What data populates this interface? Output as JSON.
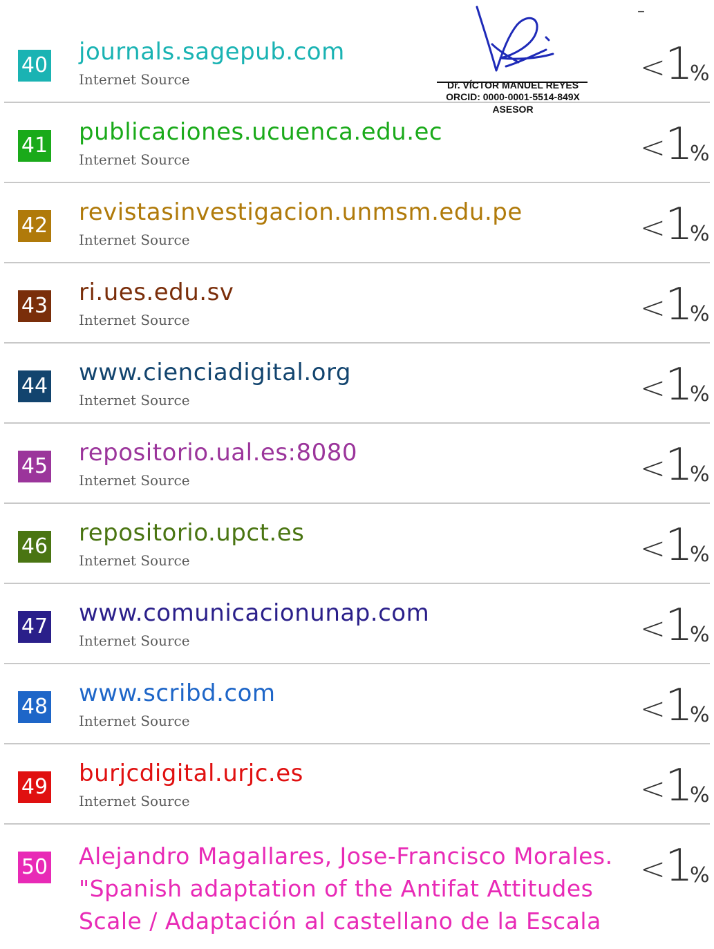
{
  "top_mark": "–",
  "signature": {
    "name": "Dr. VÍCTOR MANUEL REYES",
    "orcid": "ORCID: 0000-0001-5514-849X",
    "role": "ASESOR"
  },
  "percent": {
    "lt": "<",
    "num": "1",
    "sign": "%"
  },
  "sources": [
    {
      "num": "40",
      "title": "journals.sagepub.com",
      "type": "Internet Source",
      "color": "#1ab3b3"
    },
    {
      "num": "41",
      "title": "publicaciones.ucuenca.edu.ec",
      "type": "Internet Source",
      "color": "#1aaa1a"
    },
    {
      "num": "42",
      "title": "revistasinvestigacion.unmsm.edu.pe",
      "type": "Internet Source",
      "color": "#b07a0a"
    },
    {
      "num": "43",
      "title": "ri.ues.edu.sv",
      "type": "Internet Source",
      "color": "#7a2e0a"
    },
    {
      "num": "44",
      "title": "www.cienciadigital.org",
      "type": "Internet Source",
      "color": "#12446e"
    },
    {
      "num": "45",
      "title": "repositorio.ual.es:8080",
      "type": "Internet Source",
      "color": "#9b359b"
    },
    {
      "num": "46",
      "title": "repositorio.upct.es",
      "type": "Internet Source",
      "color": "#4a7512"
    },
    {
      "num": "47",
      "title": "www.comunicacionunap.com",
      "type": "Internet Source",
      "color": "#2a1f8a"
    },
    {
      "num": "48",
      "title": "www.scribd.com",
      "type": "Internet Source",
      "color": "#1e66c8"
    },
    {
      "num": "49",
      "title": "burjcdigital.urjc.es",
      "type": "Internet Source",
      "color": "#e01010"
    }
  ],
  "last_source": {
    "num": "50",
    "color": "#e82ab6",
    "lines": [
      "Alejandro Magallares, Jose-Francisco Morales.",
      "\"Spanish adaptation of the Antifat Attitudes",
      "Scale / Adaptación al castellano de la Escala"
    ]
  }
}
